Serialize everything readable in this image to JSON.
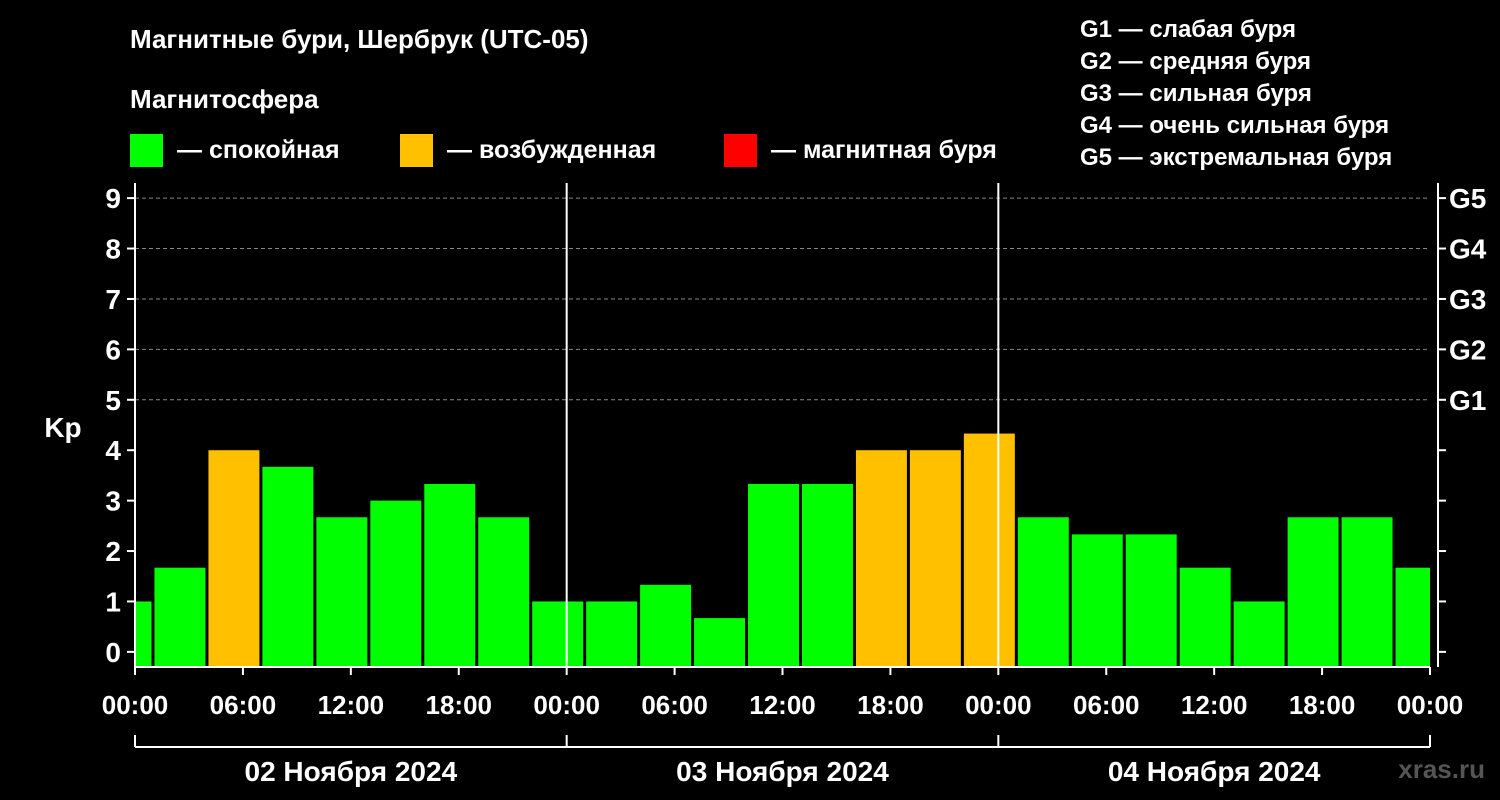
{
  "chart_data": {
    "type": "bar",
    "title": "Магнитные бури, Шербрук (UTC-05)",
    "ylabel": "Kp",
    "ylim": [
      -0.3,
      9.3
    ],
    "yticks": [
      "0",
      "1",
      "2",
      "3",
      "4",
      "5",
      "6",
      "7",
      "8",
      "9"
    ],
    "storm_levels": [
      {
        "label": "G1",
        "kp": 5
      },
      {
        "label": "G2",
        "kp": 6
      },
      {
        "label": "G3",
        "kp": 7
      },
      {
        "label": "G4",
        "kp": 8
      },
      {
        "label": "G5",
        "kp": 9
      }
    ],
    "xlim_hours": [
      0,
      72
    ],
    "x_tick_labels": [
      "00:00",
      "06:00",
      "12:00",
      "18:00",
      "00:00",
      "06:00",
      "12:00",
      "18:00",
      "00:00",
      "06:00",
      "12:00",
      "18:00",
      "00:00"
    ],
    "dates": [
      "02 Ноября 2024",
      "03 Ноября 2024",
      "04 Ноября 2024"
    ],
    "legend": {
      "heading": "Магнитосфера",
      "items": [
        {
          "label": "— спокойная",
          "color": "#00ff00"
        },
        {
          "label": "— возбужденная",
          "color": "#ffc000"
        },
        {
          "label": "— магнитная буря",
          "color": "#ff0000"
        }
      ]
    },
    "storm_legend": [
      "G1 — слабая буря",
      "G2 — средняя буря",
      "G3 — сильная буря",
      "G4 — очень сильная буря",
      "G5 — экстремальная буря"
    ],
    "colors": {
      "quiet": "#00ff00",
      "active": "#ffc000",
      "storm": "#ff0000",
      "background": "#000000",
      "grid": "#888888"
    },
    "bars": [
      {
        "start_hour": 0,
        "end_hour": 1,
        "kp": 1.0,
        "state": "quiet"
      },
      {
        "start_hour": 1,
        "end_hour": 4,
        "kp": 1.67,
        "state": "quiet"
      },
      {
        "start_hour": 4,
        "end_hour": 7,
        "kp": 4.0,
        "state": "active"
      },
      {
        "start_hour": 7,
        "end_hour": 10,
        "kp": 3.67,
        "state": "quiet"
      },
      {
        "start_hour": 10,
        "end_hour": 13,
        "kp": 2.67,
        "state": "quiet"
      },
      {
        "start_hour": 13,
        "end_hour": 16,
        "kp": 3.0,
        "state": "quiet"
      },
      {
        "start_hour": 16,
        "end_hour": 19,
        "kp": 3.33,
        "state": "quiet"
      },
      {
        "start_hour": 19,
        "end_hour": 22,
        "kp": 2.67,
        "state": "quiet"
      },
      {
        "start_hour": 22,
        "end_hour": 25,
        "kp": 1.0,
        "state": "quiet"
      },
      {
        "start_hour": 25,
        "end_hour": 28,
        "kp": 1.0,
        "state": "quiet"
      },
      {
        "start_hour": 28,
        "end_hour": 31,
        "kp": 1.33,
        "state": "quiet"
      },
      {
        "start_hour": 31,
        "end_hour": 34,
        "kp": 0.67,
        "state": "quiet"
      },
      {
        "start_hour": 34,
        "end_hour": 37,
        "kp": 3.33,
        "state": "quiet"
      },
      {
        "start_hour": 37,
        "end_hour": 40,
        "kp": 3.33,
        "state": "quiet"
      },
      {
        "start_hour": 40,
        "end_hour": 43,
        "kp": 4.0,
        "state": "active"
      },
      {
        "start_hour": 43,
        "end_hour": 46,
        "kp": 4.0,
        "state": "active"
      },
      {
        "start_hour": 46,
        "end_hour": 49,
        "kp": 4.33,
        "state": "active"
      },
      {
        "start_hour": 49,
        "end_hour": 52,
        "kp": 2.67,
        "state": "quiet"
      },
      {
        "start_hour": 52,
        "end_hour": 55,
        "kp": 2.33,
        "state": "quiet"
      },
      {
        "start_hour": 55,
        "end_hour": 58,
        "kp": 2.33,
        "state": "quiet"
      },
      {
        "start_hour": 58,
        "end_hour": 61,
        "kp": 1.67,
        "state": "quiet"
      },
      {
        "start_hour": 61,
        "end_hour": 64,
        "kp": 1.0,
        "state": "quiet"
      },
      {
        "start_hour": 64,
        "end_hour": 67,
        "kp": 2.67,
        "state": "quiet"
      },
      {
        "start_hour": 67,
        "end_hour": 70,
        "kp": 2.67,
        "state": "quiet"
      },
      {
        "start_hour": 70,
        "end_hour": 72,
        "kp": 1.67,
        "state": "quiet"
      }
    ]
  },
  "watermark": "xras.ru"
}
